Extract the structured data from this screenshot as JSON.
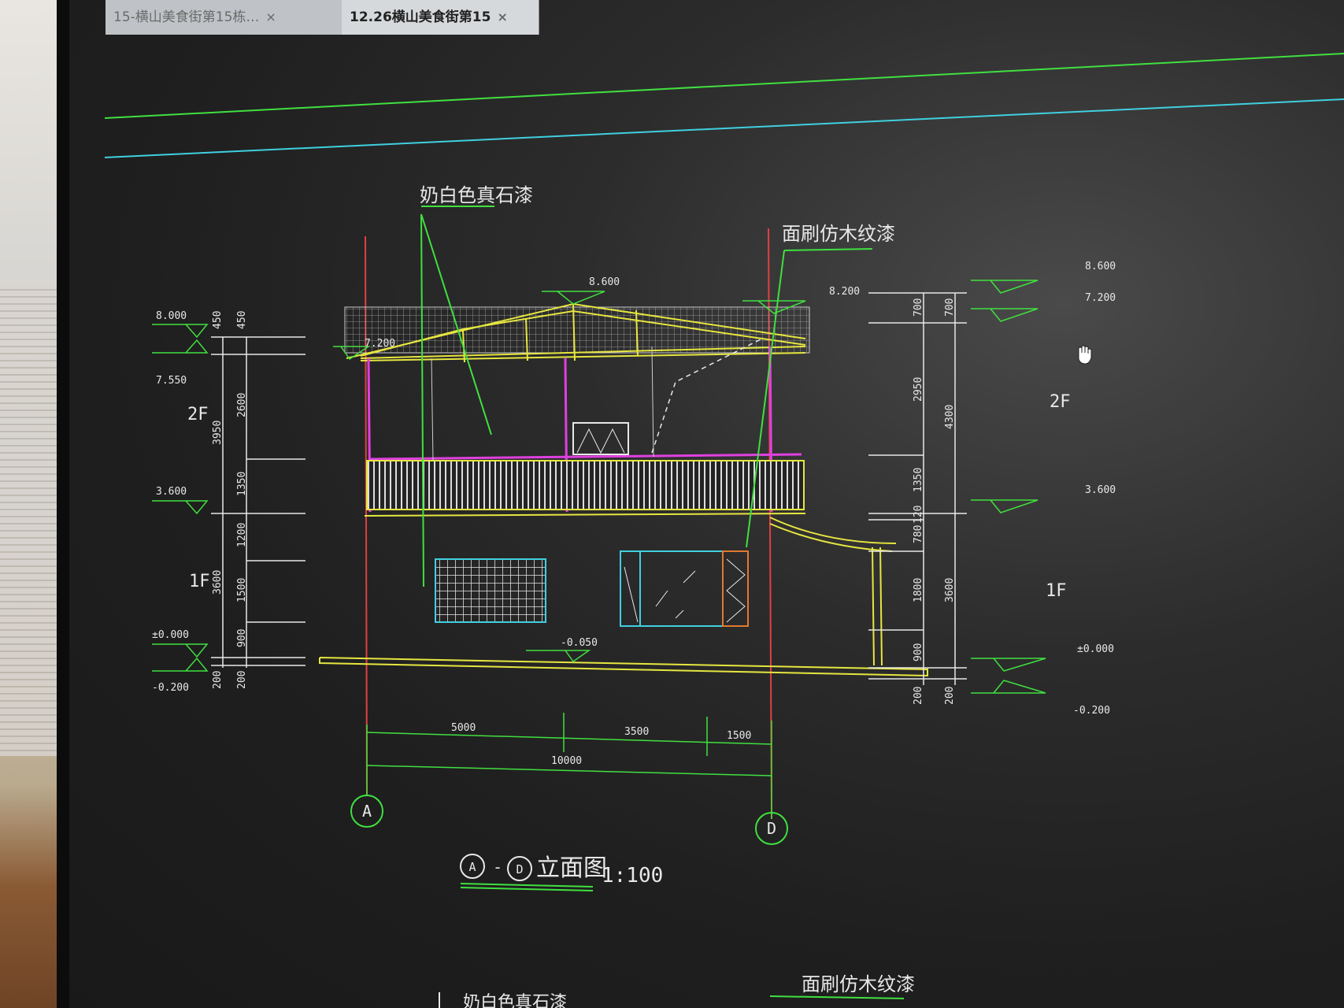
{
  "tabs": [
    {
      "label": "15-横山美食街第15栋…",
      "close": "×"
    },
    {
      "label": "12.26横山美食街第15",
      "close": "×"
    }
  ],
  "drawing": {
    "material_labels": {
      "stone_paint": "奶白色真石漆",
      "wood_paint": "面刷仿木纹漆",
      "bottom_label_1": "面刷仿木纹漆",
      "bottom_label_2": "奶白色真石漆"
    },
    "left_elevations": {
      "e8000": "8.000",
      "e7550": "7.550",
      "e3600": "3.600",
      "e0000": "±0.000",
      "em0200": "-0.200"
    },
    "left_dims_inner": [
      "450",
      "3950",
      "3600",
      "200"
    ],
    "left_dims_outer": [
      "450",
      "2600",
      "1350",
      "1200",
      "1500",
      "900",
      "200"
    ],
    "left_floors": {
      "f2": "2F",
      "f1": "1F"
    },
    "top_elevations": {
      "ridge": "8.600",
      "eave": "8.200",
      "roofline": "7.200",
      "ground": "-0.050"
    },
    "right_elevations": {
      "e8600": "8.600",
      "e7200": "7.200",
      "e3600": "3.600",
      "e0000": "±0.000",
      "em0200": "-0.200"
    },
    "right_dims_inner": [
      "700",
      "2950",
      "1350",
      "120",
      "780",
      "1800",
      "900",
      "200"
    ],
    "right_dims_outer": [
      "700",
      "4300",
      "3600",
      "200"
    ],
    "right_floors": {
      "f2": "2F",
      "f1": "1F"
    },
    "bottom_dims": {
      "d1": "5000",
      "d2": "3500",
      "d3": "1500",
      "total": "10000"
    },
    "axes": {
      "a": "A",
      "d": "D"
    },
    "title": {
      "from": "A",
      "dash": "-",
      "to": "D",
      "name": "立面图",
      "scale": "1:100"
    }
  },
  "colors": {
    "yellow": "#e6e640",
    "magenta": "#e040e0",
    "white": "#e8e8e8",
    "green": "#40e040",
    "red": "#e04040",
    "cyan": "#40d0e0",
    "orange": "#e07a30"
  }
}
